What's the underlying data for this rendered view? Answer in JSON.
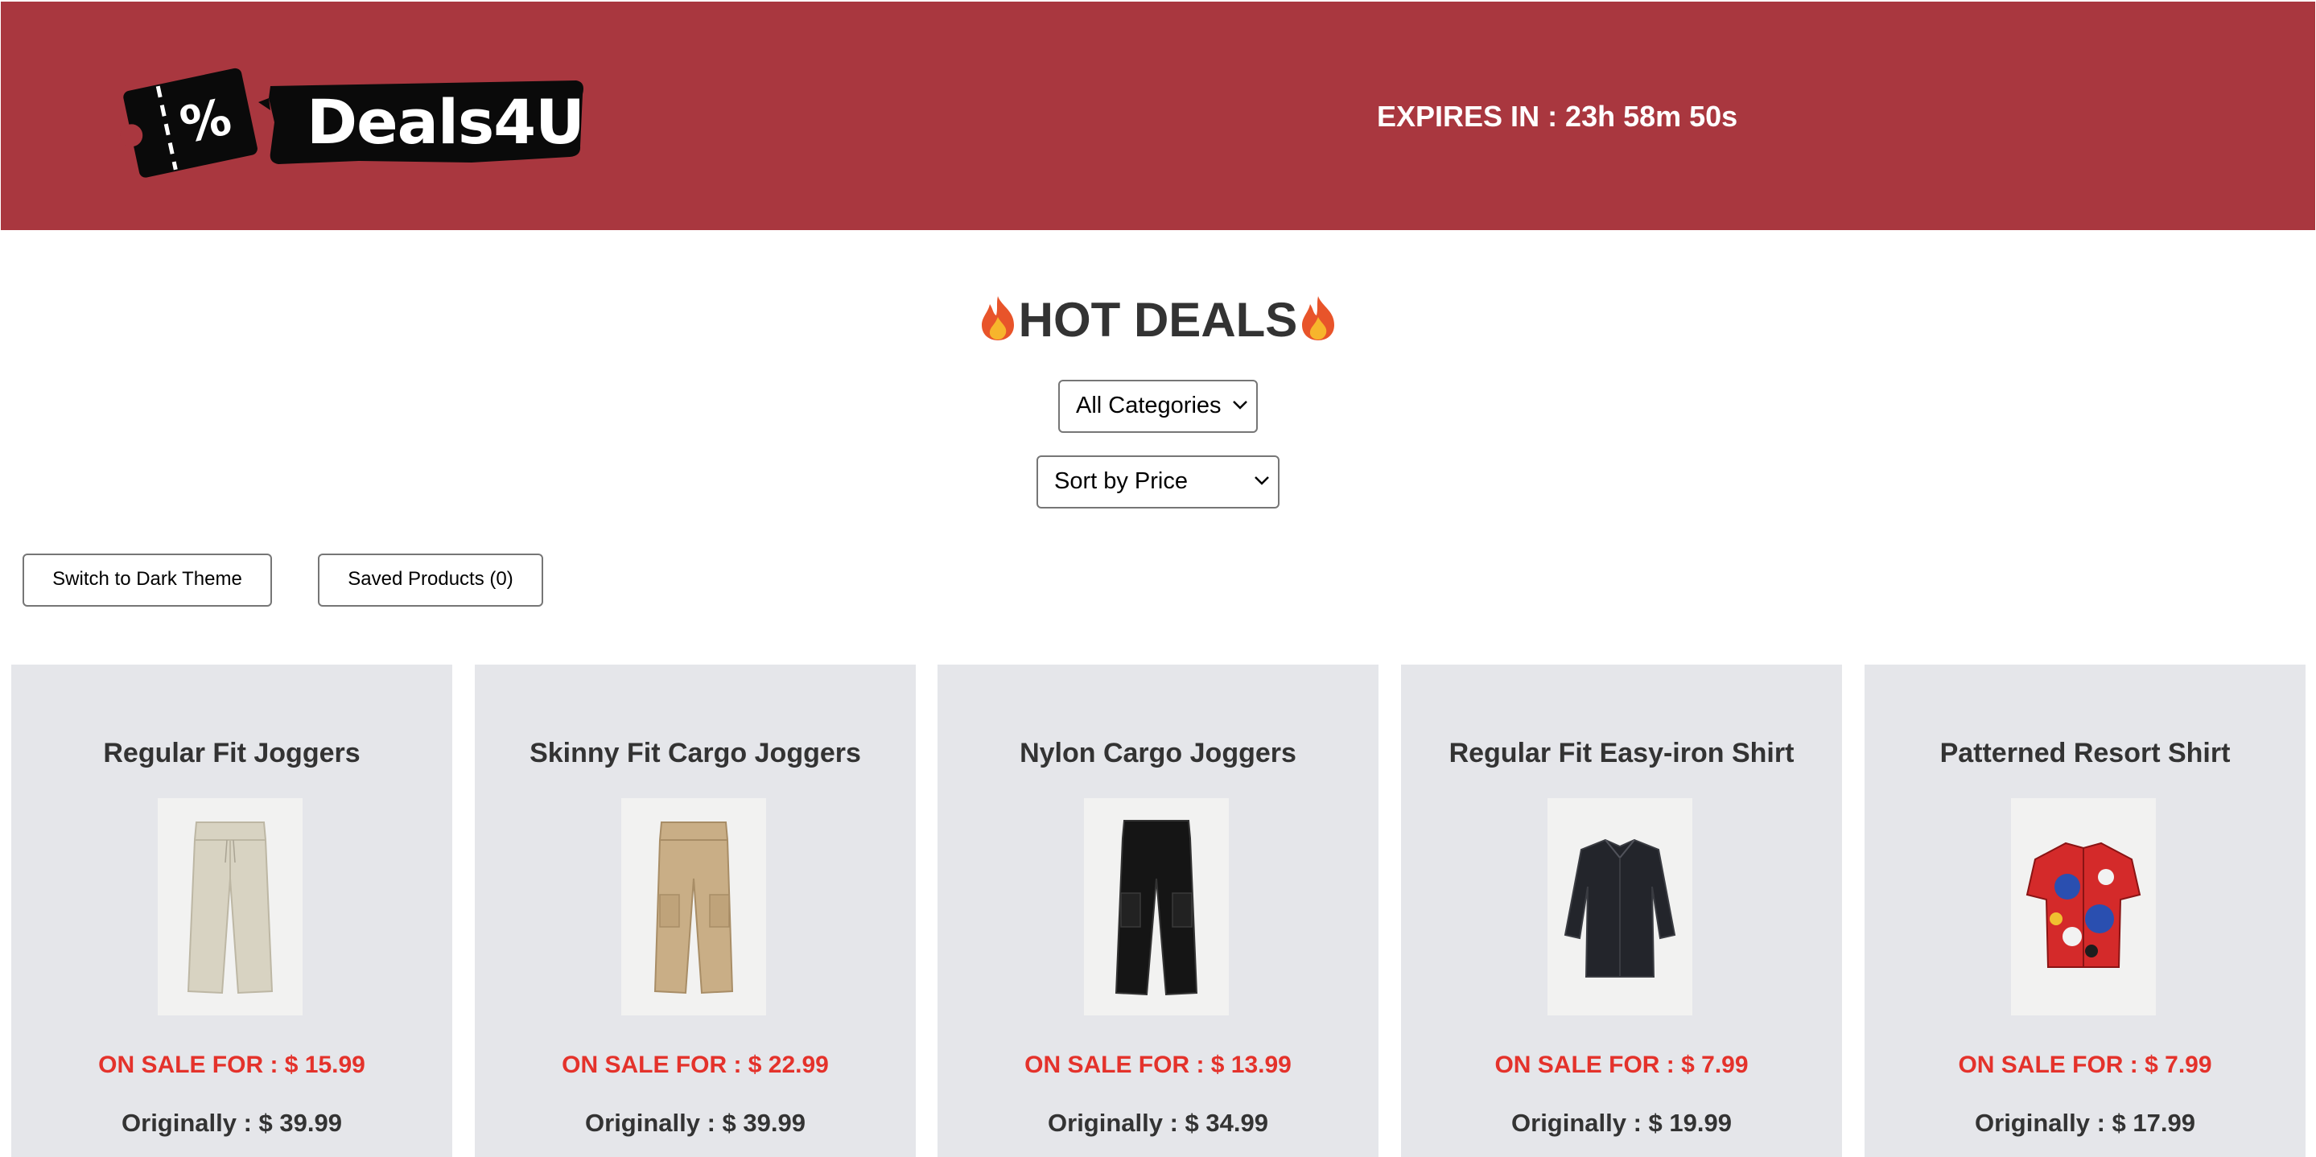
{
  "header": {
    "logo_text": "Deals4U",
    "logo_icon": "ticket-percent-icon",
    "timer": "EXPIRES IN : 23h 58m 50s",
    "background": "#a9373f"
  },
  "main": {
    "title": "HOT DEALS",
    "title_icon": "fire-icon",
    "category_select": {
      "selected": "All Categories"
    },
    "sort_select": {
      "selected": "Sort by Price"
    },
    "theme_button": "Switch to Dark Theme",
    "saved_button": "Saved Products (0)"
  },
  "products": [
    {
      "name": "Regular Fit Joggers",
      "sale": "ON SALE FOR : $ 15.99",
      "original": "Originally : $ 39.99",
      "image": "beige-joggers-image"
    },
    {
      "name": "Skinny Fit Cargo Joggers",
      "sale": "ON SALE FOR : $ 22.99",
      "original": "Originally : $ 39.99",
      "image": "khaki-cargo-joggers-image"
    },
    {
      "name": "Nylon Cargo Joggers",
      "sale": "ON SALE FOR : $ 13.99",
      "original": "Originally : $ 34.99",
      "image": "black-cargo-joggers-image"
    },
    {
      "name": "Regular Fit Easy-iron Shirt",
      "sale": "ON SALE FOR : $ 7.99",
      "original": "Originally : $ 19.99",
      "image": "black-shirt-image"
    },
    {
      "name": "Patterned Resort Shirt",
      "sale": "ON SALE FOR : $ 7.99",
      "original": "Originally : $ 17.99",
      "image": "patterned-resort-shirt-image"
    }
  ],
  "colors": {
    "sale_text": "#e4322b",
    "card_background": "#e5e6ea"
  }
}
